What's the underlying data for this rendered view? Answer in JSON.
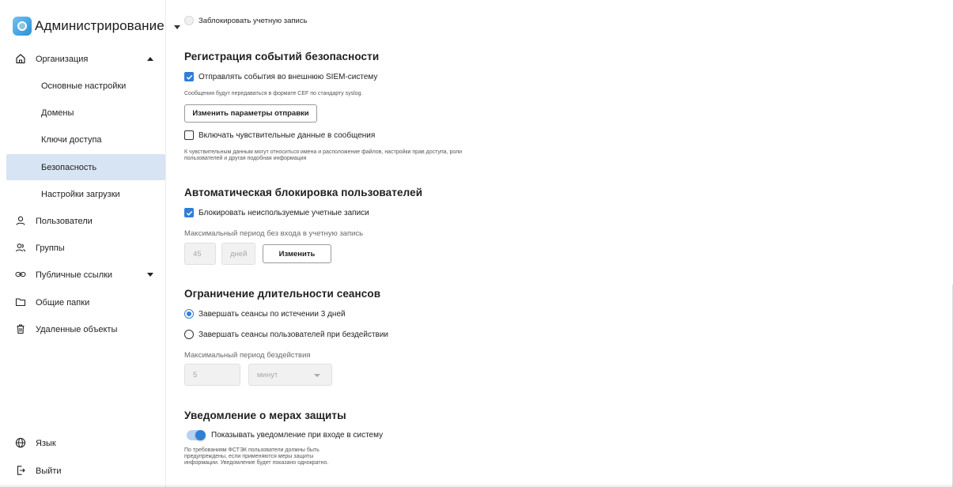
{
  "app": {
    "title": "Администрирование",
    "logo_icon": "app-logo-icon",
    "accent": "#2f7fd8"
  },
  "sidebar": {
    "items": [
      {
        "label": "Организация",
        "icon": "home-icon",
        "expanded": true
      },
      {
        "label": "Основные настройки"
      },
      {
        "label": "Домены"
      },
      {
        "label": "Ключи доступа"
      },
      {
        "label": "Безопасность",
        "active": true
      },
      {
        "label": "Настройки загрузки"
      },
      {
        "label": "Пользователи",
        "icon": "user-icon"
      },
      {
        "label": "Группы",
        "icon": "group-icon"
      },
      {
        "label": "Публичные ссылки",
        "icon": "link-icon",
        "expanded": false
      },
      {
        "label": "Общие папки",
        "icon": "folder-icon"
      },
      {
        "label": "Удаленные объекты",
        "icon": "trash-icon"
      }
    ],
    "footer": [
      {
        "label": "Язык",
        "icon": "globe-icon"
      },
      {
        "label": "Выйти",
        "icon": "logout-icon"
      }
    ]
  },
  "main": {
    "block_account": {
      "label": "Заблокировать учетную запись",
      "checked": false,
      "disabled": true
    },
    "siem": {
      "title": "Регистрация событий безопасности",
      "send_label": "Отправлять события во внешнюю SIEM-систему",
      "send_checked": true,
      "send_hint": "Сообщения будут передаваться в формате CEF по стандарту syslog.",
      "change_button": "Изменить параметры отправки",
      "sensitive_label": "Включать чувствительные данные в сообщения",
      "sensitive_checked": false,
      "sensitive_hint_1": "К чувствительным данным могут относиться имена и расположение файлов, настройки прав доступа, роли",
      "sensitive_hint_2": "пользователей и другая подобная информация"
    },
    "autolock": {
      "title": "Автоматическая блокировка пользователей",
      "lock_label": "Блокировать неиспользуемые учетные записи",
      "lock_checked": true,
      "period_label": "Максимальный период без входа в учетную запись",
      "period_value": "45",
      "period_unit": "дней",
      "change_button": "Изменить"
    },
    "sessions": {
      "title": "Ограничение длительности сеансов",
      "option_days": "Завершать сеансы по истечении 3 дней",
      "option_idle": "Завершать сеансы пользователей при бездействии",
      "selected": "option_days",
      "idle_label": "Максимальный период бездействия",
      "idle_value": "5",
      "idle_unit": "минут"
    },
    "notice": {
      "title": "Уведомление о мерах защиты",
      "toggle_label": "Показывать уведомление при входе в систему",
      "toggle_on": true,
      "hint_1": "По требованиям ФСТЭК пользователи должны быть",
      "hint_2": "предупреждены, если применяются меры защиты",
      "hint_3": "информации. Уведомление будет показано однократно."
    }
  }
}
